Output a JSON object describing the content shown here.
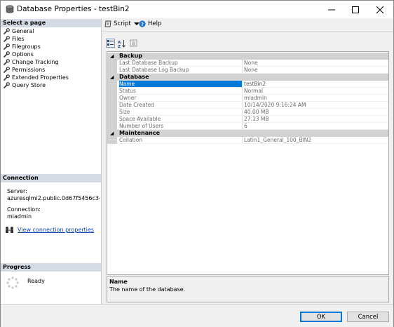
{
  "window": {
    "title": "Database Properties - testBin2"
  },
  "left_pane": {
    "select_page_header": "Select a page",
    "pages": [
      {
        "label": "General"
      },
      {
        "label": "Files"
      },
      {
        "label": "Filegroups"
      },
      {
        "label": "Options"
      },
      {
        "label": "Change Tracking"
      },
      {
        "label": "Permissions"
      },
      {
        "label": "Extended Properties"
      },
      {
        "label": "Query Store"
      }
    ],
    "connection_header": "Connection",
    "server_label": "Server:",
    "server_value": "azuresqlmi2.public.0d67f5456c3d.",
    "connection_label": "Connection:",
    "connection_value": "miadmin",
    "view_conn_link": "View connection properties",
    "progress_header": "Progress",
    "progress_status": "Ready"
  },
  "toolbar": {
    "script_label": "Script",
    "help_label": "Help"
  },
  "grid": {
    "categories": [
      {
        "name": "Backup",
        "rows": [
          {
            "key": "Last Database Backup",
            "value": "None"
          },
          {
            "key": "Last Database Log Backup",
            "value": "None"
          }
        ]
      },
      {
        "name": "Database",
        "rows": [
          {
            "key": "Name",
            "value": "testBin2",
            "selected": true
          },
          {
            "key": "Status",
            "value": "Normal"
          },
          {
            "key": "Owner",
            "value": "miadmin"
          },
          {
            "key": "Date Created",
            "value": "10/14/2020 9:16:24 AM"
          },
          {
            "key": "Size",
            "value": "40.00 MB"
          },
          {
            "key": "Space Available",
            "value": "27.13 MB"
          },
          {
            "key": "Number of Users",
            "value": "6"
          }
        ]
      },
      {
        "name": "Maintenance",
        "rows": [
          {
            "key": "Collation",
            "value": "Latin1_General_100_BIN2"
          }
        ]
      }
    ]
  },
  "description": {
    "title": "Name",
    "text": "The name of the database."
  },
  "buttons": {
    "ok": "OK",
    "cancel": "Cancel"
  },
  "colors": {
    "selection": "#0078d7",
    "category": "#d2d2d2",
    "section_header": "#d5dbe5",
    "link": "#0645ad"
  }
}
